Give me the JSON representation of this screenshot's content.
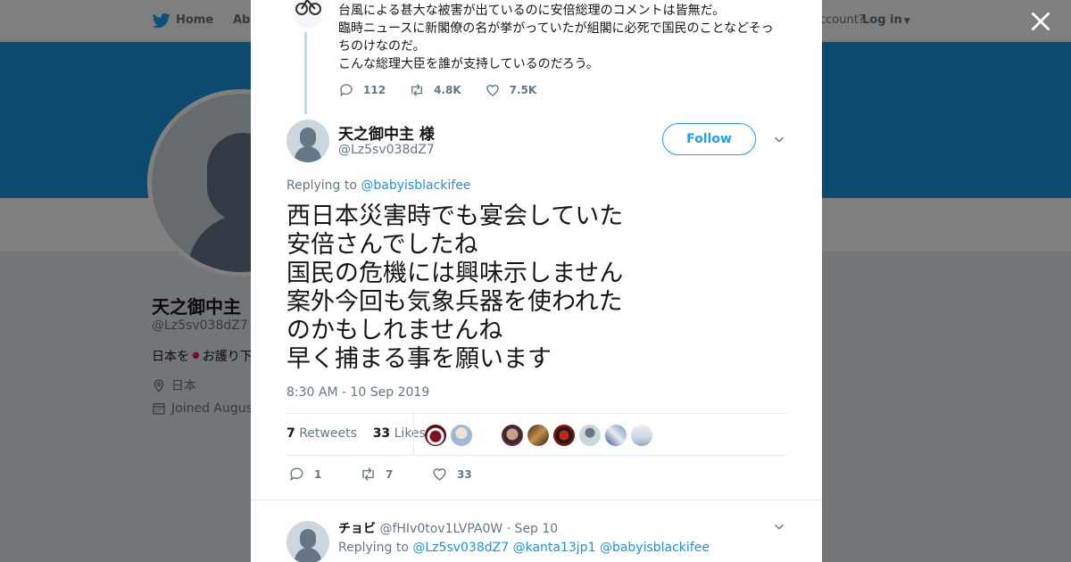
{
  "background": {
    "nav": {
      "home": "Home",
      "about": "Abo",
      "account_prompt": "ccount?",
      "login": "Log in"
    },
    "profile": {
      "name": "天之御中主",
      "handle": "@Lz5sv038dZ7",
      "bio_start": "日本を",
      "bio_rest": "お護り下",
      "location": "日本",
      "joined": "Joined August"
    },
    "colors": {
      "banner": "#1b95e0",
      "accent": "#1da1f2"
    }
  },
  "modal": {
    "parent_tweet": {
      "lines": [
        "台風による甚大な被害が出ているのに安倍総理のコメントは皆無だ。",
        "臨時ニュースに新閣僚の名が挙がっていたが組閣に必死で国民のことなどそっ",
        "ちのけなのだ。",
        "こんな総理大臣を誰が支持しているのだろう。"
      ],
      "reply_count": "112",
      "retweet_count": "4.8K",
      "like_count": "7.5K"
    },
    "tweet": {
      "name": "天之御中主 様",
      "handle": "@Lz5sv038dZ7",
      "follow_label": "Follow",
      "replying_prefix": "Replying to",
      "replying_to": "@babyisblackifee",
      "text_lines": [
        "西日本災害時でも宴会していた",
        "安倍さんでしたね",
        "国民の危機には興味示しません",
        "案外今回も気象兵器を使われた",
        "のかもしれませんね",
        "早く捕まる事を願います"
      ],
      "timestamp": "8:30 AM - 10 Sep 2019",
      "retweets": "7",
      "retweets_label": "Retweets",
      "likes": "33",
      "likes_label": "Likes",
      "reply_count": "1",
      "retweet_count": "7",
      "like_count": "33"
    },
    "reply": {
      "name": "チョビ",
      "handle": "@fHIv0tov1LVPA0W",
      "date": "· Sep 10",
      "replying_prefix": "Replying to",
      "replying_to": [
        "@Lz5sv038dZ7",
        "@kanta13jp1",
        "@babyisblackifee"
      ]
    }
  }
}
